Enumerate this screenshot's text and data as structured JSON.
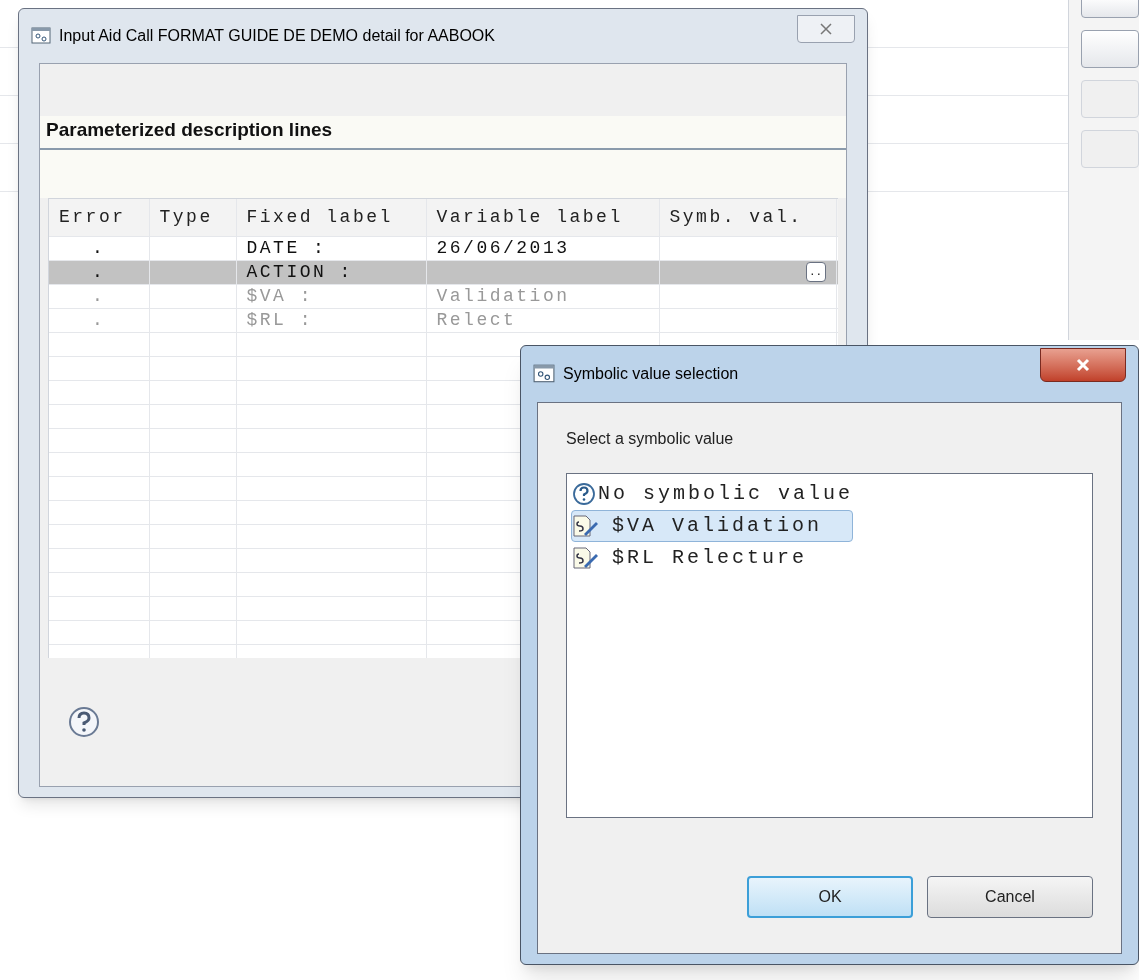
{
  "main_dialog": {
    "title": "Input Aid Call FORMAT GUIDE DE DEMO detail for AABOOK",
    "section_title": "Parameterized description lines",
    "table": {
      "columns": [
        "Error",
        "Type",
        "Fixed label",
        "Variable label",
        "Symb. val."
      ],
      "rows": [
        {
          "error": ".",
          "fixed_label": "DATE :",
          "variable_label": "26/06/2013",
          "selected": false,
          "disabled": false
        },
        {
          "error": ".",
          "fixed_label": "ACTION :",
          "symb_button": "..",
          "selected": true,
          "disabled": false
        },
        {
          "error": ".",
          "fixed_label": "$VA :",
          "variable_label": "Validation",
          "selected": false,
          "disabled": true
        },
        {
          "error": ".",
          "fixed_label": "$RL :",
          "variable_label": "Relect",
          "selected": false,
          "disabled": true
        }
      ]
    }
  },
  "symbolic_dialog": {
    "title": "Symbolic value selection",
    "prompt": "Select a symbolic value",
    "items": [
      {
        "kind": "none",
        "label": "No symbolic value",
        "selected": false
      },
      {
        "kind": "symbol",
        "label": "$VA Validation",
        "selected": true
      },
      {
        "kind": "symbol",
        "label": "$RL Relecture",
        "selected": false
      }
    ],
    "buttons": [
      {
        "label": "OK",
        "default": true
      },
      {
        "label": "Cancel",
        "default": false
      }
    ]
  }
}
